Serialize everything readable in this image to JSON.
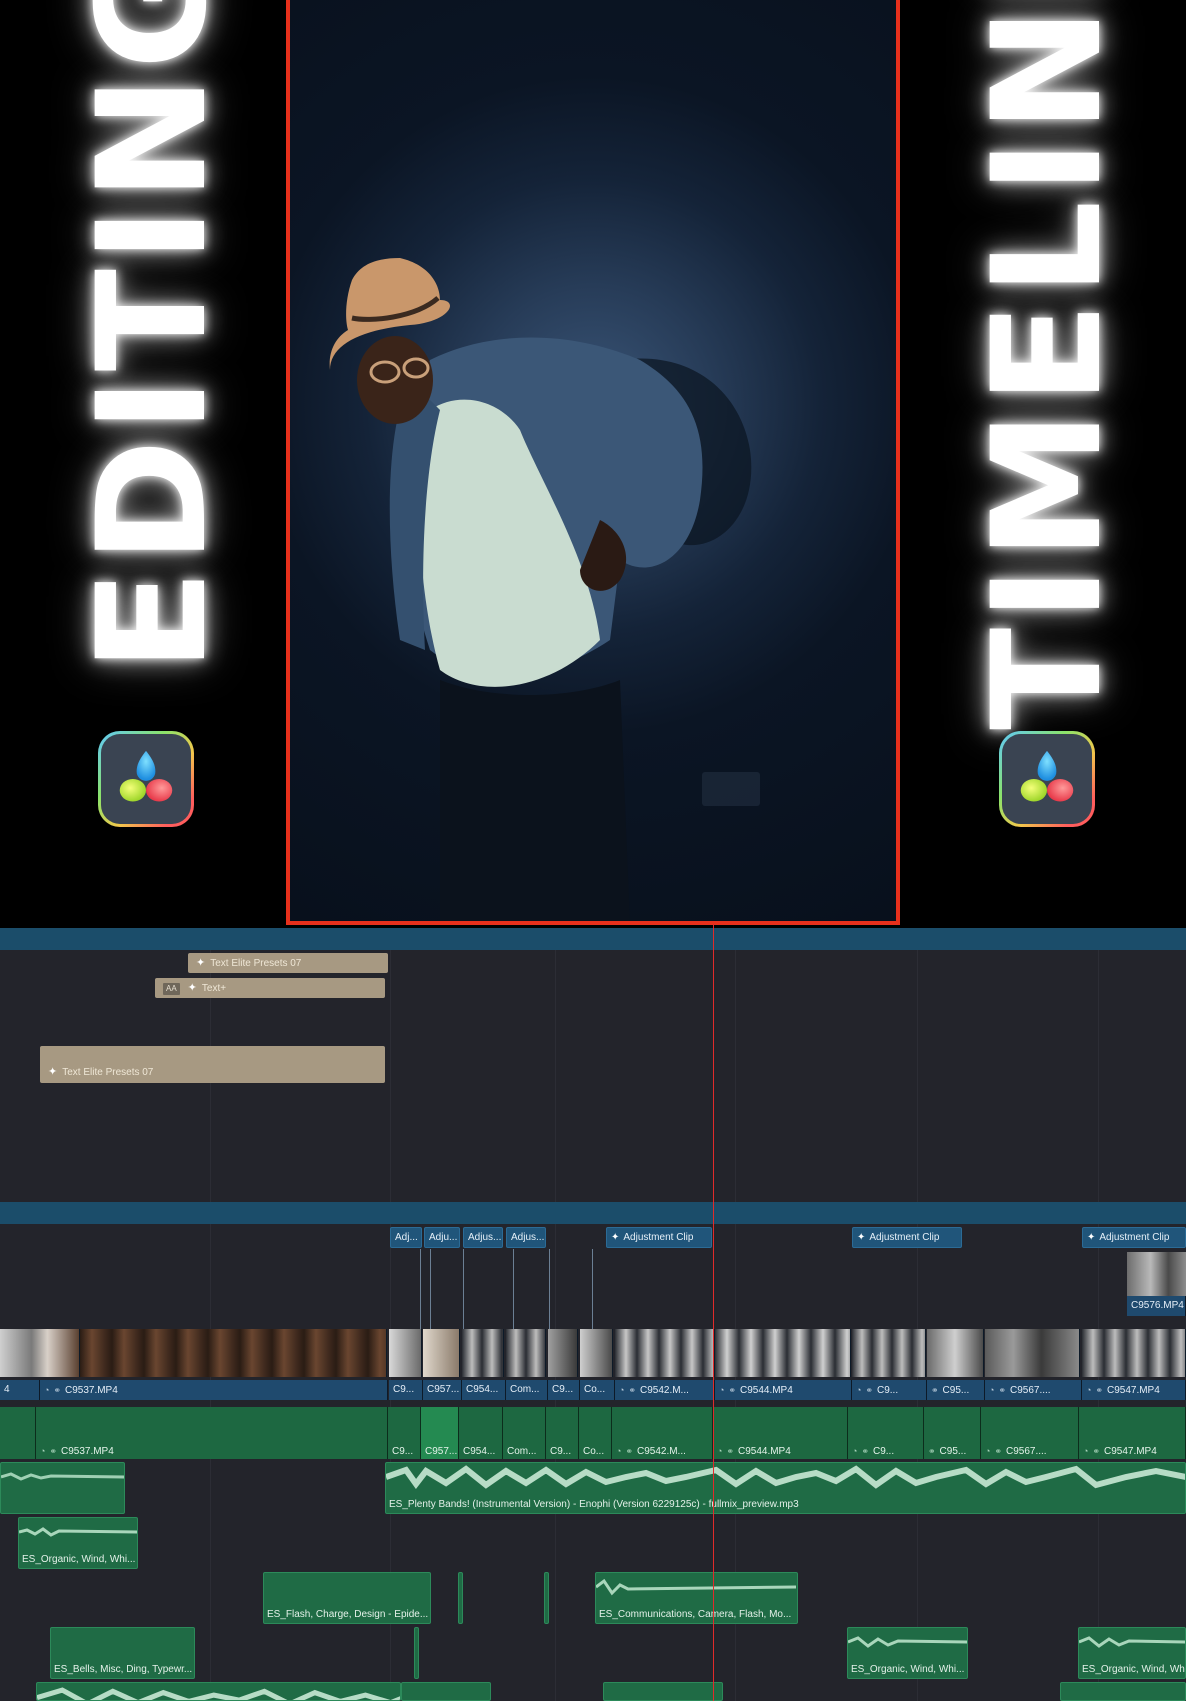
{
  "thumbnail": {
    "title_left": "EDITING",
    "title_right": "TIMELINE",
    "logo_icon": "davinci-resolve-icon",
    "preview_border_color": "#e8301c"
  },
  "timeline": {
    "title_clips": [
      {
        "label": "Text Elite Presets 07"
      },
      {
        "label": "Text+",
        "badge": "AA"
      },
      {
        "label": "Text Elite Presets 07"
      }
    ],
    "adjustment_clips": [
      "Adj...",
      "Adju...",
      "Adjus...",
      "Adjus...",
      "Adjustment Clip",
      "Adjustment Clip",
      "Adjustment Clip"
    ],
    "top_clip_label": "C9576.MP4",
    "video_track_2": [
      "4",
      "C9537.MP4",
      "C9...",
      "C957...",
      "C954...",
      "Com...",
      "C9...",
      "Co...",
      "C9542.M...",
      "C9544.MP4",
      "C9...",
      "C95...",
      "C9567....",
      "C9547.MP4"
    ],
    "video_track_1": [
      "C9537.MP4",
      "C9...",
      "C957...",
      "C954...",
      "Com...",
      "C9...",
      "Co...",
      "C9542.M...",
      "C9544.MP4",
      "C9...",
      "C95...",
      "C9567....",
      "C9547.MP4"
    ],
    "audio_music": "ES_Plenty Bands! (Instrumental Version) - Enophi (Version 6229125c) - fullmix_preview.mp3",
    "audio_sfx": [
      "ES_Organic, Wind, Whi...",
      "ES_Flash, Charge, Design - Epide...",
      "ES_Communications, Camera, Flash, Mo...",
      "ES_Bells, Misc, Ding, Typewr...",
      "ES_Organic, Wind, Whi...",
      "ES_Organic, Wind, Whi"
    ],
    "colors": {
      "video": "#1f4a6e",
      "audio": "#1f6b45",
      "title": "#a79982",
      "playhead": "#e02b2b"
    }
  }
}
